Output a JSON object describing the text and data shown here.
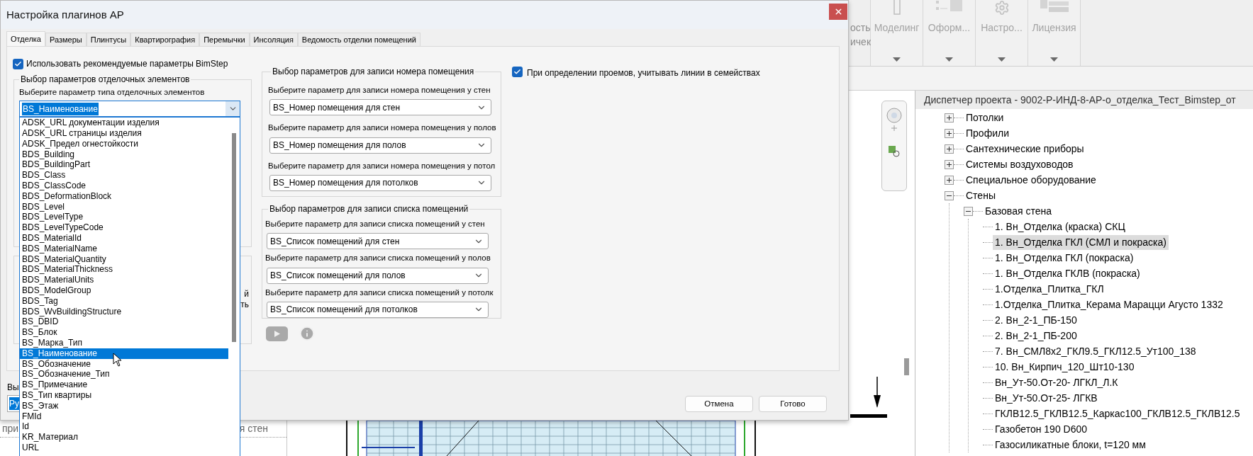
{
  "dialog": {
    "title": "Настройка плагинов АР",
    "tabs": [
      {
        "label": "Отделка",
        "selected": true
      },
      {
        "label": "Размеры",
        "selected": false
      },
      {
        "label": "Плинтусы",
        "selected": false
      },
      {
        "label": "Квартирография",
        "selected": false
      },
      {
        "label": "Перемычки",
        "selected": false
      },
      {
        "label": "Инсоляция",
        "selected": false
      },
      {
        "label": "Ведомость отделки помещений",
        "selected": false
      }
    ],
    "use_recommended": {
      "label": "Использовать рекомендуемые параметры BimStep",
      "checked": true
    },
    "finishing_group": {
      "title": "Выбор параметров отделочных элементов",
      "field_label": "Выберите параметр типа отделочных элементов",
      "value": "BS_Наименование",
      "expanded": true,
      "options": [
        {
          "label": "ADSK_URL документации изделия",
          "selected": false
        },
        {
          "label": "ADSK_URL страницы изделия",
          "selected": false
        },
        {
          "label": "ADSK_Предел огнестойкости",
          "selected": false
        },
        {
          "label": "BDS_Building",
          "selected": false
        },
        {
          "label": "BDS_BuildingPart",
          "selected": false
        },
        {
          "label": "BDS_Class",
          "selected": false
        },
        {
          "label": "BDS_ClassCode",
          "selected": false
        },
        {
          "label": "BDS_DeformationBlock",
          "selected": false
        },
        {
          "label": "BDS_Level",
          "selected": false
        },
        {
          "label": "BDS_LevelType",
          "selected": false
        },
        {
          "label": "BDS_LevelTypeCode",
          "selected": false
        },
        {
          "label": "BDS_MaterialId",
          "selected": false
        },
        {
          "label": "BDS_MaterialName",
          "selected": false
        },
        {
          "label": "BDS_MaterialQuantity",
          "selected": false
        },
        {
          "label": "BDS_MaterialThickness",
          "selected": false
        },
        {
          "label": "BDS_MaterialUnits",
          "selected": false
        },
        {
          "label": "BDS_ModelGroup",
          "selected": false
        },
        {
          "label": "BDS_Tag",
          "selected": false
        },
        {
          "label": "BDS_WvBuildingStructure",
          "selected": false
        },
        {
          "label": "BS_DBID",
          "selected": false
        },
        {
          "label": "BS_Блок",
          "selected": false
        },
        {
          "label": "BS_Марка_Тип",
          "selected": false
        },
        {
          "label": "BS_Наименование",
          "selected": true
        },
        {
          "label": "BS_Обозначение",
          "selected": false
        },
        {
          "label": "BS_Обозначение_Тип",
          "selected": false
        },
        {
          "label": "BS_Примечание",
          "selected": false
        },
        {
          "label": "BS_Тип квартиры",
          "selected": false
        },
        {
          "label": "BS_Этаж",
          "selected": false
        },
        {
          "label": "FMId",
          "selected": false
        },
        {
          "label": "Id",
          "selected": false
        },
        {
          "label": "KR_Материал",
          "selected": false
        },
        {
          "label": "URL",
          "selected": false
        }
      ]
    },
    "covered_group_text": [
      "й",
      "ть"
    ],
    "bottom_label": "Вы",
    "bottom_value": "Ру",
    "groups": [
      {
        "title": "Выбор параметров для записи номера помещения",
        "fields": [
          {
            "label": "Выберите параметр для записи номера помещения у стен",
            "value": "BS_Номер помещения для стен"
          },
          {
            "label": "Выберите параметр для записи номера помещения у полов",
            "value": "BS_Номер помещения для полов"
          },
          {
            "label": "Выберите параметр для записи номера помещения у потол",
            "value": "BS_Номер помещения для потолков"
          }
        ]
      },
      {
        "title": "Выбор параметров для записи списка помещений",
        "fields": [
          {
            "label": "Выберите параметр для записи списка помещений у стен",
            "value": "BS_Список помещений для стен"
          },
          {
            "label": "Выберите параметр для записи списка помещений у полов",
            "value": "BS_Список помещений для полов"
          },
          {
            "label": "Выберите параметр для записи списка помещений у потолк",
            "value": "BS_Список помещений для потолков"
          }
        ]
      }
    ],
    "consider_lines": {
      "label": "При определении проемов, учитывать линии в семействах",
      "checked": true
    },
    "buttons": [
      "Отмена",
      "Готово"
    ]
  },
  "ribbon": {
    "partial_panel": [
      "ость",
      "ичек"
    ],
    "panels": [
      {
        "label": "Моделинг",
        "kind": "bar"
      },
      {
        "label": "Оформ...",
        "kind": "diagram"
      },
      {
        "label": "Настро...",
        "kind": "gear"
      },
      {
        "label": "Лицензия",
        "kind": "logo"
      }
    ]
  },
  "properties": {
    "row_fragments": [
      "при",
      "я стен"
    ]
  },
  "project_browser": {
    "title": "Диспетчер проекта - 9002-Р-ИНД-8-АР-о_отделка_Тест_Bimstep_от",
    "tree": [
      {
        "label": "Потолки",
        "expanded": false,
        "selected": false
      },
      {
        "label": "Профили",
        "expanded": false,
        "selected": false
      },
      {
        "label": "Сантехнические приборы",
        "expanded": false,
        "selected": false
      },
      {
        "label": "Системы воздуховодов",
        "expanded": false,
        "selected": false
      },
      {
        "label": "Специальное оборудование",
        "expanded": false,
        "selected": false
      },
      {
        "label": "Стены",
        "expanded": true,
        "selected": false,
        "children": [
          {
            "label": "Базовая стена",
            "expanded": true,
            "selected": false,
            "children": [
              {
                "label": "1. Вн_Отделка (краска) СКЦ",
                "selected": false
              },
              {
                "label": "1. Вн_Отделка ГКЛ (СМЛ и покраска)",
                "selected": true
              },
              {
                "label": "1. Вн_Отделка ГКЛ (покраска)",
                "selected": false
              },
              {
                "label": "1. Вн_Отделка ГКЛВ (покраска)",
                "selected": false
              },
              {
                "label": "1.Отделка_Плитка_ГКЛ",
                "selected": false
              },
              {
                "label": "1.Отделка_Плитка_Керама Марацци Агусто 1332",
                "selected": false
              },
              {
                "label": "2. Вн_2-1_ПБ-150",
                "selected": false
              },
              {
                "label": "2. Вн_2-1_ПБ-200",
                "selected": false
              },
              {
                "label": "7. Вн_СМЛ8х2_ГКЛ9.5_ГКЛ12.5_Ут100_138",
                "selected": false
              },
              {
                "label": "10. Вн_Кирпич_120_Шт10-130",
                "selected": false
              },
              {
                "label": "Вн_Ут-50.От-20- ЛГКЛ_Л.К",
                "selected": false
              },
              {
                "label": "Вн_Ут-50.От-25- ЛГКВ",
                "selected": false
              },
              {
                "label": "ГКЛВ12.5_ГКЛВ12.5_Каркас100_ГКЛВ12.5_ГКЛВ12.5",
                "selected": false
              },
              {
                "label": "Газобетон 190 D600",
                "selected": false
              },
              {
                "label": "Газосиликатные блоки, t=120 мм",
                "selected": false
              }
            ]
          }
        ]
      }
    ]
  }
}
